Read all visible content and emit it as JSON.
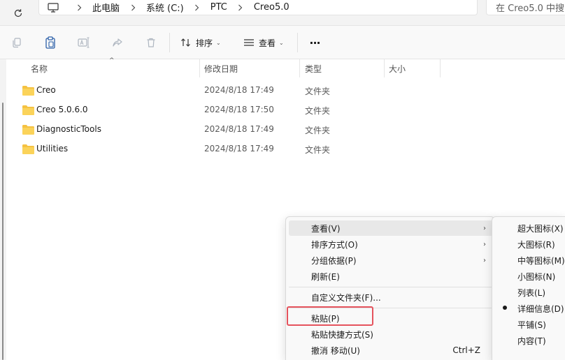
{
  "address_bar": {
    "crumbs": [
      "此电脑",
      "系统 (C:)",
      "PTC",
      "Creo5.0"
    ],
    "search_placeholder": "在 Creo5.0 中搜"
  },
  "toolbar": {
    "sort_label": "排序",
    "view_label": "查看",
    "more_label": "···"
  },
  "columns": {
    "name": "名称",
    "modified": "修改日期",
    "type": "类型",
    "size": "大小"
  },
  "files": [
    {
      "name": "Creo",
      "modified": "2024/8/18 17:49",
      "type": "文件夹"
    },
    {
      "name": "Creo 5.0.6.0",
      "modified": "2024/8/18 17:50",
      "type": "文件夹"
    },
    {
      "name": "DiagnosticTools",
      "modified": "2024/8/18 17:49",
      "type": "文件夹"
    },
    {
      "name": "Utilities",
      "modified": "2024/8/18 17:49",
      "type": "文件夹"
    }
  ],
  "context_menu": {
    "items": [
      {
        "label": "查看(V)",
        "submenu": true,
        "highlighted": true
      },
      {
        "label": "排序方式(O)",
        "submenu": true
      },
      {
        "label": "分组依据(P)",
        "submenu": true
      },
      {
        "label": "刷新(E)"
      },
      {
        "label": "自定义文件夹(F)..."
      },
      {
        "label": "粘贴(P)",
        "outlined": true
      },
      {
        "label": "粘贴快捷方式(S)"
      },
      {
        "label": "撤消 移动(U)",
        "shortcut": "Ctrl+Z"
      }
    ]
  },
  "view_submenu": {
    "items": [
      {
        "label": "超大图标(X)"
      },
      {
        "label": "大图标(R)"
      },
      {
        "label": "中等图标(M)"
      },
      {
        "label": "小图标(N)"
      },
      {
        "label": "列表(L)"
      },
      {
        "label": "详细信息(D)",
        "checked": true
      },
      {
        "label": "平铺(S)"
      },
      {
        "label": "内容(T)"
      }
    ]
  },
  "colors": {
    "folder": "#f5c242",
    "accent": "#0067c0",
    "highlight_outline": "#e5535d"
  }
}
